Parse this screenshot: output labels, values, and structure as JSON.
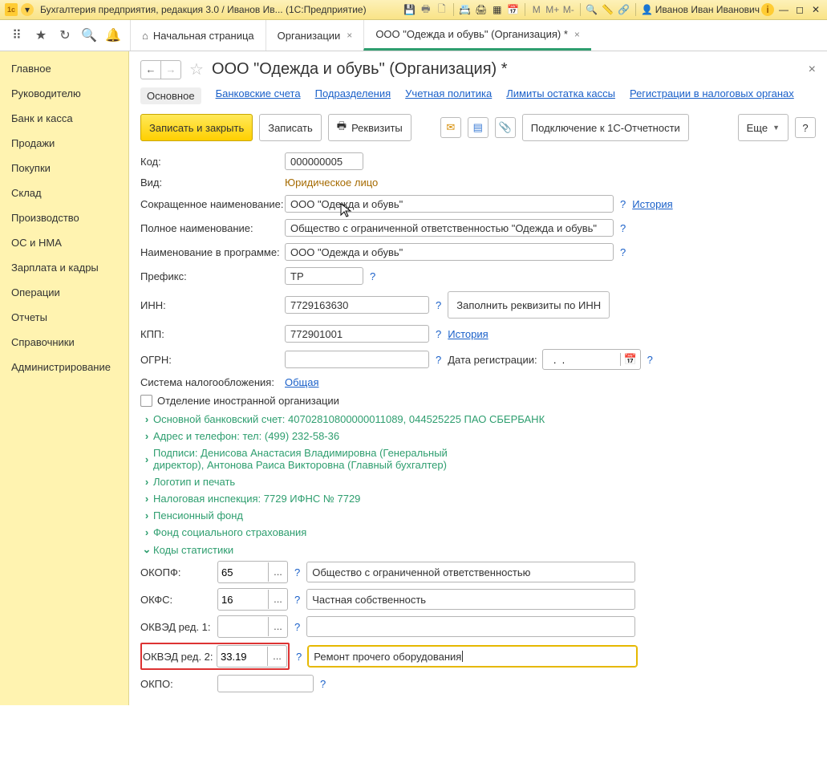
{
  "titlebar": {
    "text": "Бухгалтерия предприятия, редакция 3.0 / Иванов Ив... (1С:Предприятие)",
    "user": "Иванов Иван Иванович"
  },
  "top_icons": {
    "m": "M",
    "mplus": "M+",
    "mminus": "M-"
  },
  "tabs": {
    "home": "Начальная страница",
    "t1": "Организации",
    "t2": "ООО \"Одежда и обувь\" (Организация) *"
  },
  "sidebar": [
    "Главное",
    "Руководителю",
    "Банк и касса",
    "Продажи",
    "Покупки",
    "Склад",
    "Производство",
    "ОС и НМА",
    "Зарплата и кадры",
    "Операции",
    "Отчеты",
    "Справочники",
    "Администрирование"
  ],
  "page": {
    "title": "ООО \"Одежда и обувь\" (Организация) *"
  },
  "subtabs": {
    "main": "Основное",
    "bank": "Банковские счета",
    "dept": "Подразделения",
    "policy": "Учетная политика",
    "limits": "Лимиты остатка кассы",
    "reg": "Регистрации в налоговых органах"
  },
  "toolbar": {
    "save_close": "Записать и закрыть",
    "save": "Записать",
    "req": "Реквизиты",
    "connect": "Подключение к 1С-Отчетности",
    "more": "Еще"
  },
  "labels": {
    "code": "Код:",
    "kind": "Вид:",
    "short": "Сокращенное наименование:",
    "full": "Полное наименование:",
    "prog": "Наименование в программе:",
    "prefix": "Префикс:",
    "inn": "ИНН:",
    "kpp": "КПП:",
    "ogrn": "ОГРН:",
    "sys": "Система налогообложения:",
    "foreign": "Отделение иностранной организации",
    "regdate": "Дата регистрации:",
    "fill_inn": "Заполнить реквизиты по ИНН",
    "history": "История",
    "common": "Общая"
  },
  "values": {
    "code": "000000005",
    "kind": "Юридическое лицо",
    "short": "ООО \"Одежда и обувь\"",
    "full": "Общество с ограниченной ответственностью \"Одежда и обувь\"",
    "prog": "ООО \"Одежда и обувь\"",
    "prefix": "ТР",
    "inn": "7729163630",
    "kpp": "772901001",
    "ogrn": "",
    "regdate": "  .  .    "
  },
  "expanders": {
    "bank": "Основной банковский счет: 40702810800000011089, 044525225 ПАО СБЕРБАНК",
    "addr": "Адрес и телефон: тел: (499) 232-58-36",
    "sign": "Подписи: Денисова Анастасия Владимировна (Генеральный директор), Антонова Раиса Викторовна (Главный бухгалтер)",
    "logo": "Логотип и печать",
    "tax": "Налоговая инспекция: 7729 ИФНС № 7729",
    "pens": "Пенсионный фонд",
    "soc": "Фонд социального страхования",
    "stat": "Коды статистики"
  },
  "stat": {
    "okopf_l": "ОКОПФ:",
    "okopf": "65",
    "okopf_d": "Общество с ограниченной ответственностью",
    "okfs_l": "ОКФС:",
    "okfs": "16",
    "okfs_d": "Частная собственность",
    "okved1_l": "ОКВЭД ред. 1:",
    "okved1": "",
    "okved1_d": "",
    "okved2_l": "ОКВЭД ред. 2:",
    "okved2": "33.19",
    "okved2_d": "Ремонт прочего оборудования",
    "okpo_l": "ОКПО:",
    "okpo": ""
  }
}
